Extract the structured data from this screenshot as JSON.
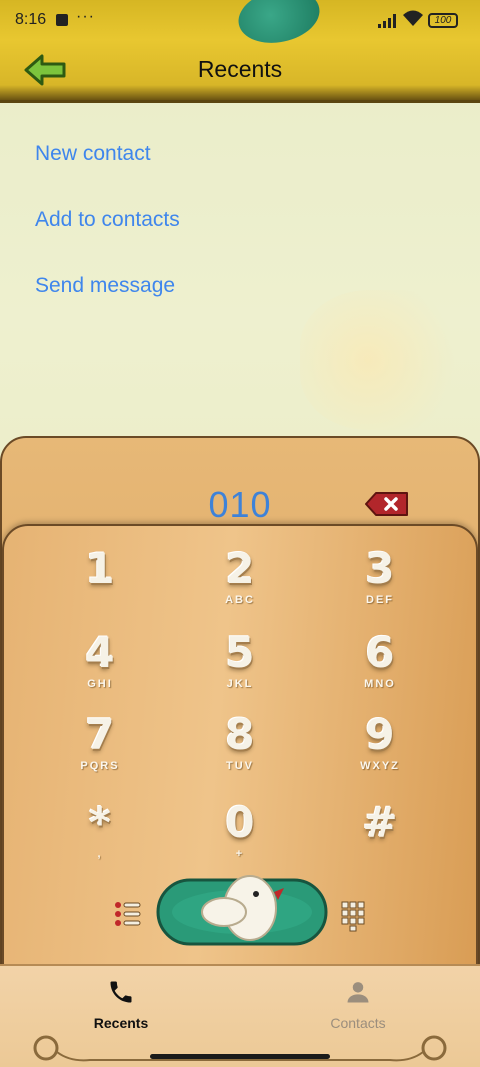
{
  "status_bar": {
    "time": "8:16",
    "dots": "···",
    "battery": "100"
  },
  "header": {
    "title": "Recents",
    "back_icon": "back-arrow-icon"
  },
  "actions": [
    {
      "label": "New contact"
    },
    {
      "label": "Add to contacts"
    },
    {
      "label": "Send message"
    }
  ],
  "dialer": {
    "number": "010",
    "keys": [
      {
        "digit": "1",
        "letters": ""
      },
      {
        "digit": "2",
        "letters": "ABC"
      },
      {
        "digit": "3",
        "letters": "DEF"
      },
      {
        "digit": "4",
        "letters": "GHI"
      },
      {
        "digit": "5",
        "letters": "JKL"
      },
      {
        "digit": "6",
        "letters": "MNO"
      },
      {
        "digit": "7",
        "letters": "PQRS"
      },
      {
        "digit": "8",
        "letters": "TUV"
      },
      {
        "digit": "9",
        "letters": "WXYZ"
      },
      {
        "digit": "*",
        "letters": ","
      },
      {
        "digit": "0",
        "letters": "+"
      },
      {
        "digit": "#",
        "letters": ""
      }
    ]
  },
  "bottom_nav": {
    "tabs": [
      {
        "label": "Recents",
        "icon": "phone-icon",
        "active": true
      },
      {
        "label": "Contacts",
        "icon": "person-icon",
        "active": false
      }
    ]
  },
  "colors": {
    "accent_link": "#3f86ec",
    "header": "#e0c02c",
    "dialer_panel": "#e2ad6b",
    "call_button": "#2a9a78"
  }
}
